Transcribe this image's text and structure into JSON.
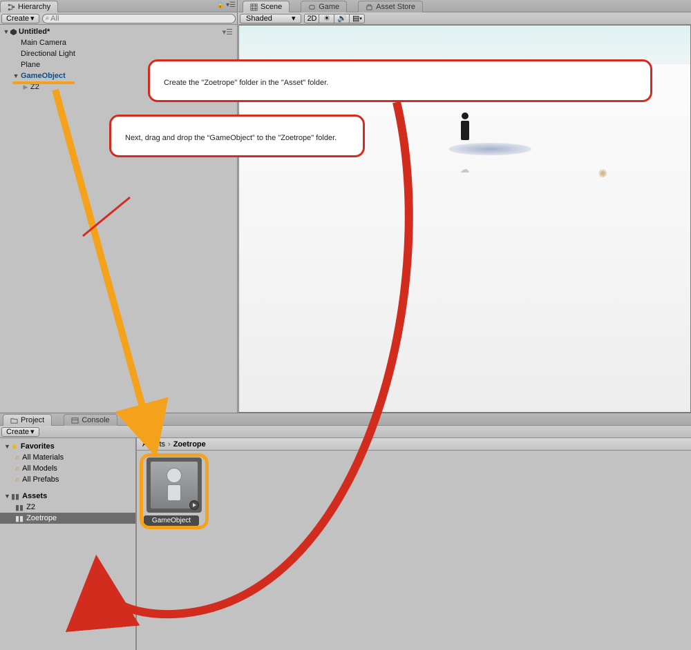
{
  "hierarchy": {
    "tab_label": "Hierarchy",
    "create_btn": "Create",
    "search_placeholder": "All",
    "scene_name": "Untitled*",
    "items": [
      "Main Camera",
      "Directional Light",
      "Plane",
      "GameObject",
      "Z2"
    ]
  },
  "scene": {
    "tabs": {
      "scene": "Scene",
      "game": "Game",
      "store": "Asset Store"
    },
    "toolbar": {
      "shading": "Shaded",
      "mode_2d": "2D"
    }
  },
  "callouts": {
    "c1": "Create the \"Zoetrope\" folder in the \"Asset\" folder.",
    "c2": " Next, drag and drop the “GameObject” to the \"Zoetrope\" folder."
  },
  "project": {
    "tabs": {
      "project": "Project",
      "console": "Console"
    },
    "create_btn": "Create",
    "favorites_label": "Favorites",
    "favorites": [
      "All Materials",
      "All Models",
      "All Prefabs"
    ],
    "assets_label": "Assets",
    "asset_folders": [
      "Z2",
      "Zoetrope"
    ],
    "selected_folder": "Zoetrope",
    "breadcrumb": {
      "root": "Assets",
      "current": "Zoetrope"
    },
    "tiles": [
      {
        "name": "GameObject",
        "highlighted": true
      }
    ]
  }
}
